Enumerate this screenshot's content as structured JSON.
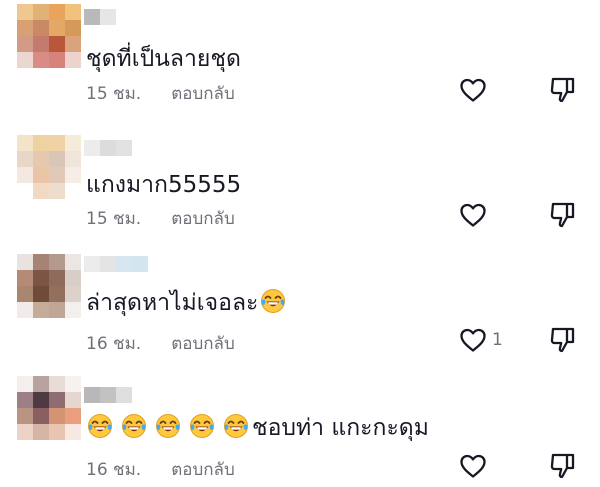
{
  "comments": [
    {
      "text": "ชุดที่เป็นลายชุด",
      "emoji_prefix": [],
      "time": "15 ชม.",
      "reply": "ตอบกลับ",
      "likes": ""
    },
    {
      "text": "แกงมาก55555",
      "emoji_prefix": [],
      "time": "15 ชม.",
      "reply": "ตอบกลับ",
      "likes": ""
    },
    {
      "text": "ล่าสุดหาไม่เจอละ",
      "emoji_suffix": [
        "face-with-tears-of-joy"
      ],
      "time": "16 ชม.",
      "reply": "ตอบกลับ",
      "likes": "1"
    },
    {
      "text": "ชอบท่า แกะกะดุม",
      "emoji_prefix": [
        "face-with-tears-of-joy",
        "face-with-tears-of-joy",
        "face-with-tears-of-joy",
        "face-with-tears-of-joy",
        "face-with-tears-of-joy"
      ],
      "time": "16 ชม.",
      "reply": "ตอบกลับ",
      "likes": ""
    }
  ],
  "icons": {
    "like": "heart-outline-icon",
    "dislike": "thumbs-down-outline-icon"
  },
  "colors": {
    "text": "#161823",
    "meta": "#6f7079",
    "icon": "#161823",
    "emoji_face": "#FFC83D"
  }
}
